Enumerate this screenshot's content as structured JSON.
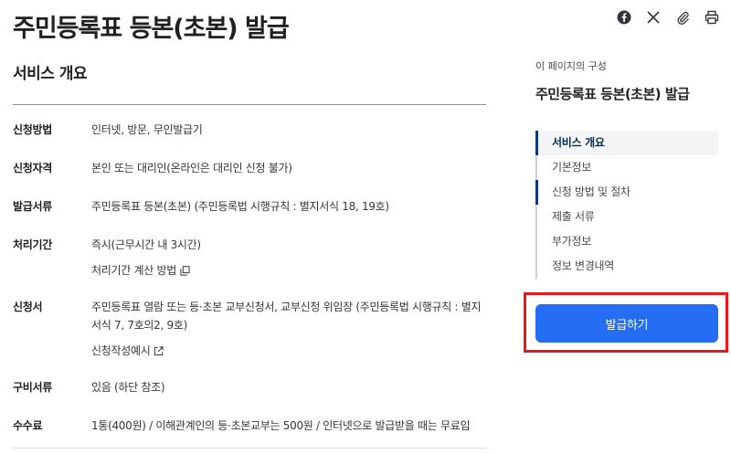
{
  "page_title": "주민등록표 등본(초본) 발급",
  "share_icons": [
    "facebook-icon",
    "x-icon",
    "attach-icon",
    "print-icon"
  ],
  "section": {
    "title": "서비스 개요"
  },
  "rows": [
    {
      "label": "신청방법",
      "value": "인터넷, 방문, 무인발급기"
    },
    {
      "label": "신청자격",
      "value": "본인 또는 대리인(온라인은 대리인 신청 불가)"
    },
    {
      "label": "발급서류",
      "value": "주민등록표 등본(초본) (주민등록법 시행규칙 : 별지서식 18, 19호)"
    },
    {
      "label": "처리기간",
      "value": "즉시(근무시간 내 3시간)",
      "link": "처리기간 계산 방법"
    },
    {
      "label": "신청서",
      "value": "주민등록표 열람 또는 등·초본 교부신청서, 교부신청 위임장 (주민등록법 시행규칙 : 별지서식 7, 7호의2, 9호)",
      "link": "신청작성예시"
    },
    {
      "label": "구비서류",
      "value": "있음 (하단 참조)"
    },
    {
      "label": "수수료",
      "value": "1통(400원) / 이해관계인의 등·초본교부는 500원 / 인터넷으로 발급받을 때는 무료임"
    }
  ],
  "toc": {
    "caption": "이 페이지의 구성",
    "title": "주민등록표 등본(초본) 발급",
    "items": [
      {
        "label": "서비스 개요"
      },
      {
        "label": "기본정보"
      },
      {
        "label": "신청 방법 및 절차"
      },
      {
        "label": "제출 서류"
      },
      {
        "label": "부가정보"
      },
      {
        "label": "정보 변경내역"
      }
    ]
  },
  "cta": {
    "label": "발급하기"
  },
  "colors": {
    "primary": "#256ef4",
    "highlight": "#e8161d",
    "toc_active": "#0b3b75"
  }
}
